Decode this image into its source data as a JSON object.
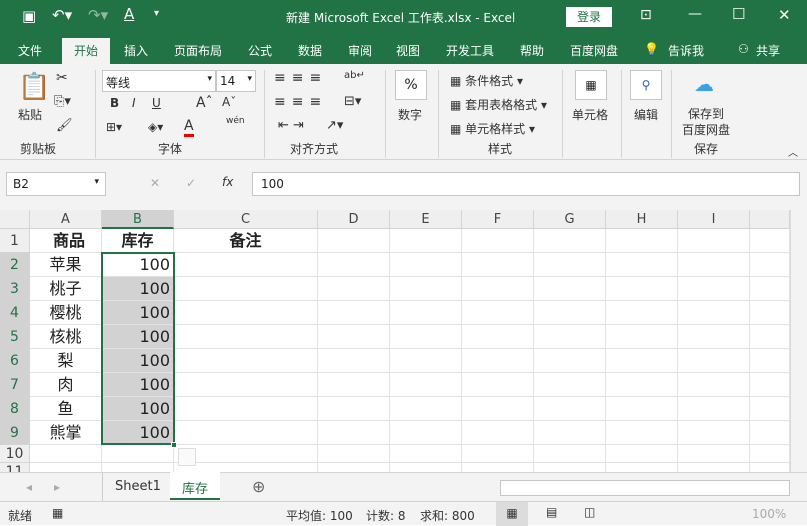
{
  "title_bar": {
    "title": "新建 Microsoft Excel 工作表.xlsx  -  Excel",
    "login": "登录",
    "icons": [
      "save-icon",
      "undo-icon",
      "redo-icon",
      "font-color-icon",
      "customize-icon",
      "ribbon-display-icon",
      "minimize-icon",
      "maximize-icon",
      "close-icon"
    ]
  },
  "tabs": [
    "文件",
    "开始",
    "插入",
    "页面布局",
    "公式",
    "数据",
    "审阅",
    "视图",
    "开发工具",
    "帮助",
    "百度网盘",
    "告诉我",
    "共享"
  ],
  "ribbon": {
    "paste": "粘贴",
    "clipboard": "剪贴板",
    "font_name": "等线",
    "font_size": "14",
    "font": "字体",
    "alignment": "对齐方式",
    "number": "数字",
    "cond_format": "条件格式",
    "table_format": "套用表格格式",
    "cell_style": "单元格样式",
    "styles": "样式",
    "cells": "单元格",
    "edit": "编辑",
    "save_baidu": "保存到\n百度网盘",
    "save": "保存",
    "bold": "B",
    "italic": "I",
    "underline": "U",
    "wen": "wén"
  },
  "formula_bar": {
    "name_box": "B2",
    "fx": "fx",
    "value": "100"
  },
  "columns": [
    "A",
    "B",
    "C",
    "D",
    "E",
    "F",
    "G",
    "H",
    "I"
  ],
  "rows": [
    "1",
    "2",
    "3",
    "4",
    "5",
    "6",
    "7",
    "8",
    "9",
    "10",
    "11"
  ],
  "cells": {
    "header": [
      "商品",
      "库存",
      "备注"
    ],
    "items": [
      "苹果",
      "桃子",
      "樱桃",
      "核桃",
      "梨",
      "肉",
      "鱼",
      "熊掌"
    ],
    "stock": [
      "100",
      "100",
      "100",
      "100",
      "100",
      "100",
      "100",
      "100"
    ]
  },
  "sheets": [
    "Sheet1",
    "库存"
  ],
  "status": {
    "ready": "就绪",
    "average": "平均值: 100",
    "count": "计数: 8",
    "sum": "求和: 800",
    "zoom": "100%"
  },
  "colors": {
    "accent": "#217346",
    "selection": "#d2d2d2"
  }
}
